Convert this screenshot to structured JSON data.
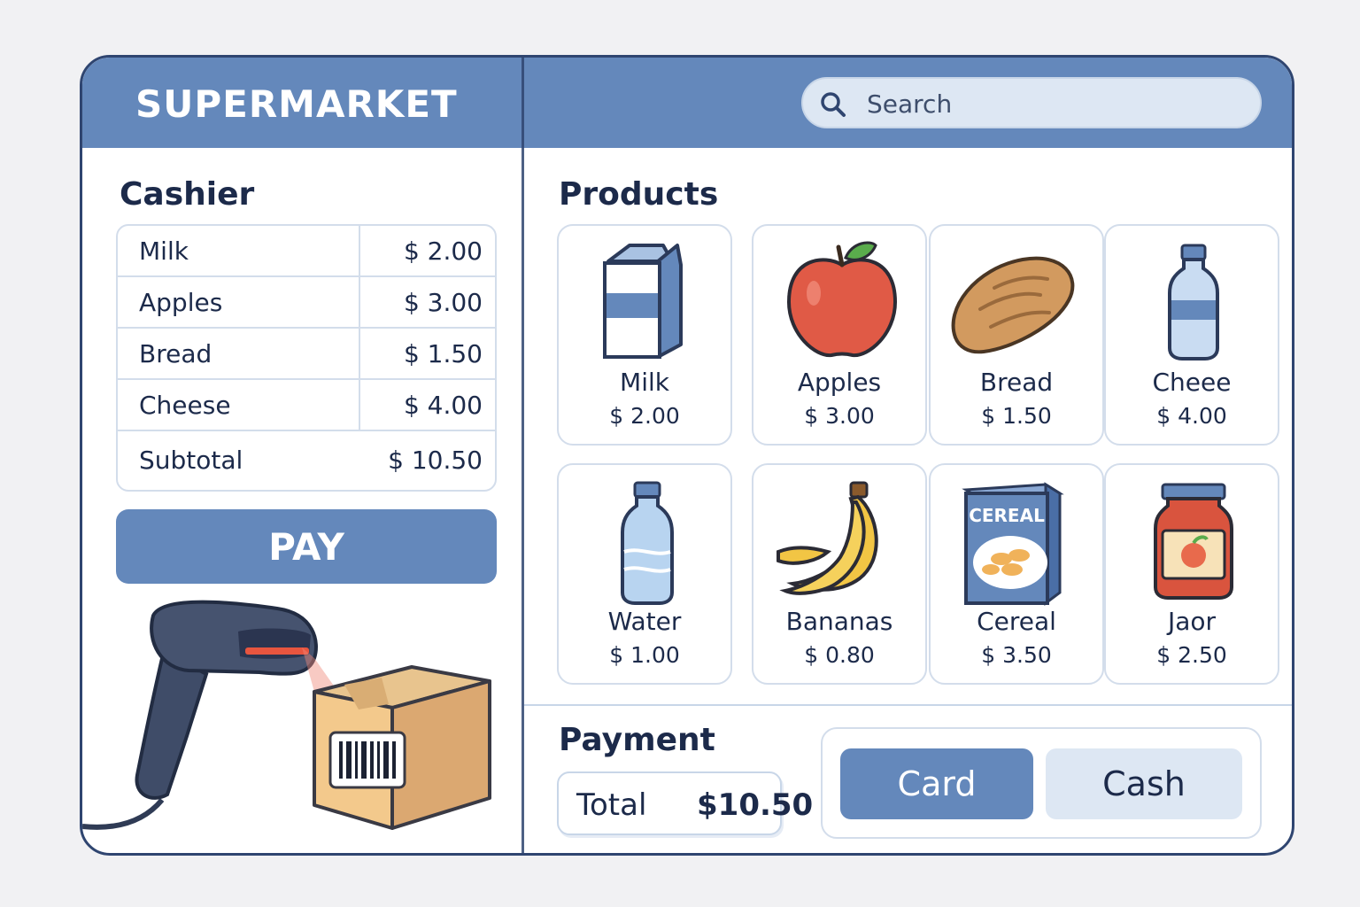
{
  "app": {
    "title": "SUPERMARKET"
  },
  "search": {
    "placeholder": "Search"
  },
  "cashier": {
    "title": "Cashier",
    "items": [
      {
        "name": "Milk",
        "price": "$ 2.00"
      },
      {
        "name": "Apples",
        "price": "$ 3.00"
      },
      {
        "name": "Bread",
        "price": "$ 1.50"
      },
      {
        "name": "Cheese",
        "price": "$ 4.00"
      }
    ],
    "subtotal_label": "Subtotal",
    "subtotal_value": "$ 10.50",
    "pay_label": "PAY"
  },
  "products": {
    "title": "Products",
    "items": [
      {
        "name": "Milk",
        "price": "$ 2.00",
        "icon": "milk-carton-icon"
      },
      {
        "name": "Apples",
        "price": "$ 3.00",
        "icon": "apple-icon"
      },
      {
        "name": "Bread",
        "price": "$ 1.50",
        "icon": "bread-icon"
      },
      {
        "name": "Cheee",
        "price": "$ 4.00",
        "icon": "bottle-icon"
      },
      {
        "name": "Water",
        "price": "$ 1.00",
        "icon": "water-bottle-icon"
      },
      {
        "name": "Bananas",
        "price": "$ 0.80",
        "icon": "banana-icon"
      },
      {
        "name": "Cereal",
        "price": "$ 3.50",
        "icon": "cereal-box-icon",
        "box_text": "CEREAL"
      },
      {
        "name": "Jaor",
        "price": "$ 2.50",
        "icon": "jar-icon"
      }
    ]
  },
  "payment": {
    "title": "Payment",
    "total_label": "Total",
    "total_value": "$10.50",
    "card_label": "Card",
    "cash_label": "Cash"
  },
  "colors": {
    "header": "#6488bb",
    "border": "#2f4570",
    "accent_light": "#dde7f3",
    "text": "#1c2a4a"
  }
}
